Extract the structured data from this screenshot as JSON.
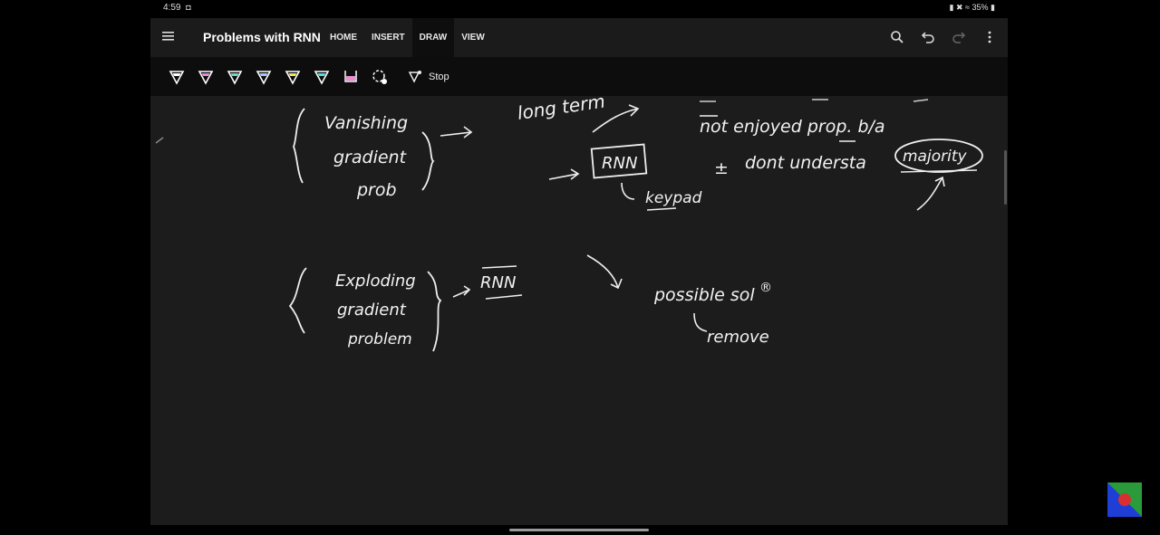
{
  "status": {
    "time": "4:59",
    "record_mark": "◘",
    "battery": "35%"
  },
  "appbar": {
    "title": "Problems with RNN",
    "tabs": [
      {
        "label": "HOME",
        "active": false
      },
      {
        "label": "INSERT",
        "active": false
      },
      {
        "label": "DRAW",
        "active": true
      },
      {
        "label": "VIEW",
        "active": false
      }
    ],
    "icons": [
      "search-icon",
      "undo-icon",
      "redo-icon",
      "more-icon"
    ]
  },
  "toolbar": {
    "pens": [
      {
        "name": "pen-white",
        "color": "#ffffff"
      },
      {
        "name": "pen-pink",
        "color": "#e987d8"
      },
      {
        "name": "pen-teal",
        "color": "#6fd6c8"
      },
      {
        "name": "pen-blue",
        "color": "#a9c4ff"
      },
      {
        "name": "highlighter-yellow",
        "color": "#f0e65a"
      },
      {
        "name": "highlighter-cyan",
        "color": "#52dede"
      },
      {
        "name": "highlighter-magenta",
        "color": "#e88fd0"
      },
      {
        "name": "lasso-add",
        "color": "#ffffff"
      }
    ],
    "stop_label": "Stop"
  },
  "ink": {
    "vanishing": "Vanishing",
    "gradient1": "gradient",
    "prob": "prob",
    "long_term": "long term",
    "rnn1": "RNN",
    "keypad": "keypad",
    "not_enjoyed": "not enjoyed prop. b/a",
    "dont_understand": "dont understa",
    "majority": "majority",
    "exploding": "Exploding",
    "gradient2": "gradient",
    "problem": "problem",
    "rnn2": "RNN",
    "possible": "possible sol",
    "remove": "remove"
  }
}
